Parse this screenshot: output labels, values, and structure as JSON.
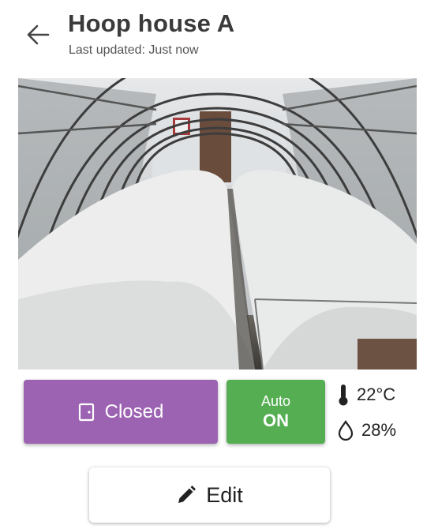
{
  "header": {
    "back_icon": "arrow-left-icon",
    "title": "Hoop house A",
    "subtitle": "Last updated: Just now"
  },
  "photo": {
    "subject": "greenhouse-photo"
  },
  "controls": {
    "door": {
      "icon": "door-icon",
      "label": "Closed",
      "color": "#9d63b3"
    },
    "auto": {
      "label": "Auto",
      "state": "ON",
      "color": "#55ae52"
    }
  },
  "readings": {
    "temperature": {
      "icon": "thermometer-icon",
      "value": "22°C"
    },
    "humidity": {
      "icon": "water-drop-icon",
      "value": "28%"
    }
  },
  "edit": {
    "icon": "pencil-icon",
    "label": "Edit"
  }
}
